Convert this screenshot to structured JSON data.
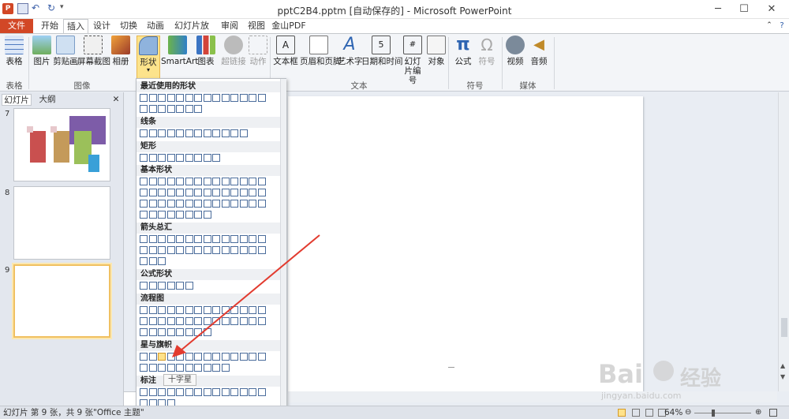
{
  "window": {
    "title": "pptC2B4.pptm [自动保存的] - Microsoft PowerPoint"
  },
  "tabs": [
    "文件",
    "开始",
    "插入",
    "设计",
    "切换",
    "动画",
    "幻灯片放映",
    "审阅",
    "视图",
    "金山PDF"
  ],
  "ribbon": {
    "buttons": [
      "表格",
      "图片",
      "剪贴画",
      "屏幕截图",
      "相册",
      "形状",
      "SmartArt",
      "图表",
      "超链接",
      "动作",
      "文本框",
      "页眉和页脚",
      "艺术字",
      "日期和时间",
      "幻灯片编号",
      "对象",
      "公式",
      "符号",
      "视频",
      "音频"
    ],
    "groups": [
      "表格",
      "图像",
      "文本",
      "符号",
      "媒体"
    ]
  },
  "panes": {
    "tab_slides": "幻灯片",
    "tab_outline": "大纲",
    "close": "✕"
  },
  "slides": [
    "7",
    "8",
    "9"
  ],
  "gallery": {
    "categories": [
      "最近使用的形状",
      "线条",
      "矩形",
      "基本形状",
      "箭头总汇",
      "公式形状",
      "流程图",
      "星与旗帜",
      "标注"
    ],
    "tooltip": "十字星"
  },
  "status": {
    "slide_info": "幻灯片 第 9 张，共 9 张",
    "theme": "\"Office 主题\"",
    "zoom": "64%"
  },
  "watermark": {
    "brand": "Bai",
    "brand2": "经验",
    "url": "jingyan.baidu.com"
  }
}
